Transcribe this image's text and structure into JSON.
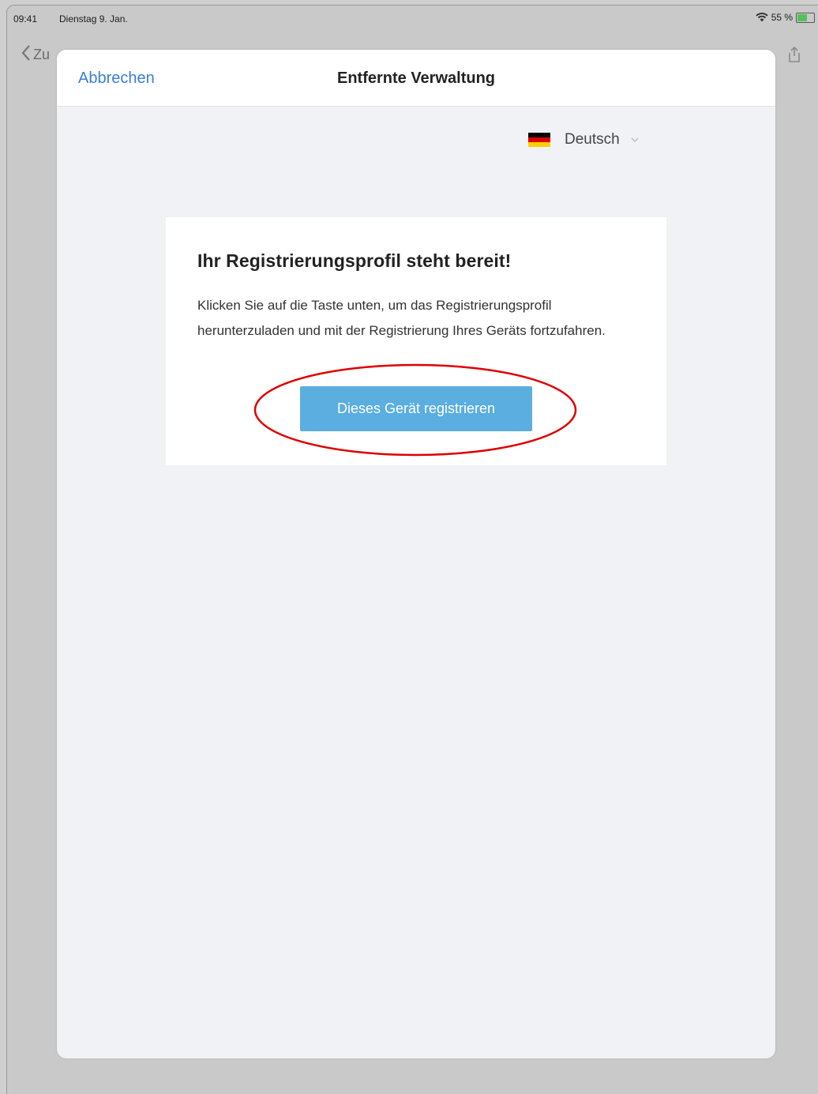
{
  "statusbar": {
    "time": "09:41",
    "date": "Dienstag 9. Jan.",
    "battery": "55 %"
  },
  "background": {
    "back_label": "Zu"
  },
  "sheet": {
    "cancel_label": "Abbrechen",
    "title": "Entfernte Verwaltung",
    "language": {
      "selected": "Deutsch",
      "flag_colors": [
        "#000000",
        "#dd0000",
        "#ffce00"
      ]
    },
    "card": {
      "title": "Ihr Registrierungsprofil steht bereit!",
      "body": "Klicken Sie auf die Taste unten, um das Registrierungsprofil herunterzuladen und mit der Registrierung Ihres Geräts fortzufahren.",
      "button_label": "Dieses Gerät registrieren"
    }
  },
  "colors": {
    "accent_link": "#3b7dd8",
    "button_bg": "#5aaee0",
    "highlight": "#e00000"
  }
}
